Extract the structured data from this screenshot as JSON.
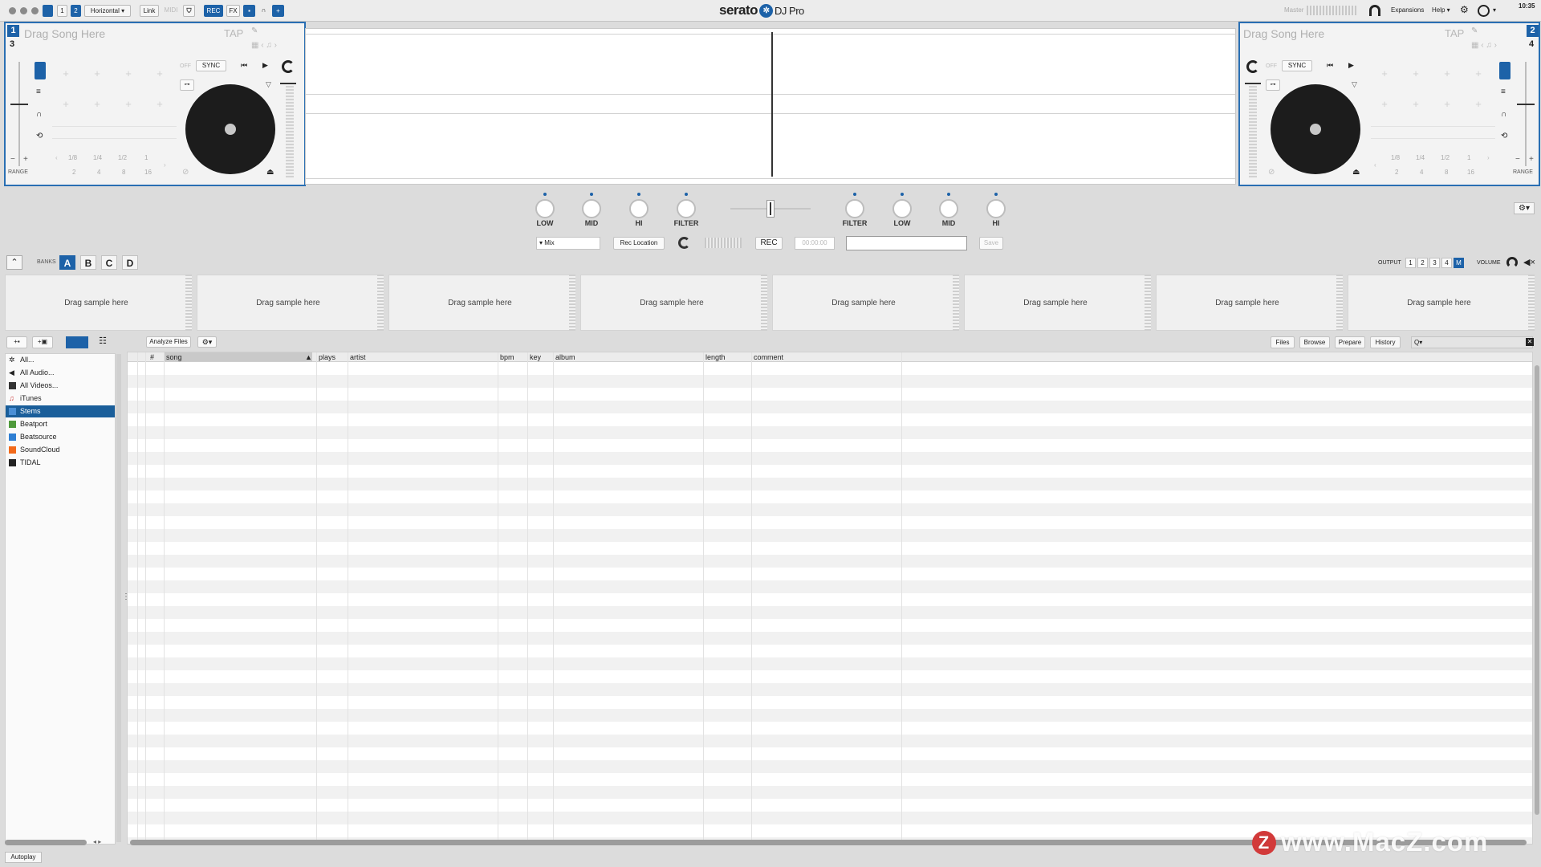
{
  "topbar": {
    "deck1": "1",
    "deck2": "2",
    "layout": "Horizontal ▾",
    "link": "Link",
    "midi": "MIDI",
    "rec": "REC",
    "fx": "FX",
    "logo_brand": "serato",
    "logo_product": "DJ Pro",
    "master": "Master",
    "expansions": "Expansions",
    "help": "Help ▾",
    "clock": "10:35"
  },
  "deck_left": {
    "number": "1",
    "sub_number": "3",
    "drag_text": "Drag Song Here",
    "tap": "TAP",
    "off": "OFF",
    "sync": "SYNC",
    "range": "RANGE",
    "minus": "−",
    "plus": "+",
    "loops_top": [
      "1/8",
      "1/4",
      "1/2",
      "1"
    ],
    "loops_bottom": [
      "2",
      "4",
      "8",
      "16"
    ]
  },
  "deck_right": {
    "number": "2",
    "sub_number": "4",
    "drag_text": "Drag Song Here",
    "tap": "TAP",
    "off": "OFF",
    "sync": "SYNC",
    "range": "RANGE",
    "minus": "−",
    "plus": "+",
    "loops_top": [
      "1/8",
      "1/4",
      "1/2",
      "1"
    ],
    "loops_bottom": [
      "2",
      "4",
      "8",
      "16"
    ]
  },
  "mixer": {
    "left_knobs": [
      "LOW",
      "MID",
      "HI",
      "FILTER"
    ],
    "right_knobs": [
      "FILTER",
      "LOW",
      "MID",
      "HI"
    ],
    "mix_source": "▾ Mix",
    "rec_location": "Rec Location",
    "rec": "REC",
    "rec_time": "00:00:00",
    "save": "Save"
  },
  "sampler": {
    "banks_label": "BANKS",
    "banks": [
      "A",
      "B",
      "C",
      "D"
    ],
    "active_bank": "A",
    "output_label": "OUTPUT",
    "outputs": [
      "1",
      "2",
      "3",
      "4",
      "M"
    ],
    "volume_label": "VOLUME",
    "slot_text": "Drag sample here"
  },
  "library": {
    "analyze": "Analyze Files",
    "tabs": [
      "Files",
      "Browse",
      "Prepare",
      "History"
    ],
    "search_placeholder": "Q▾",
    "columns": [
      "#",
      "song",
      "plays",
      "artist",
      "bpm",
      "key",
      "album",
      "length",
      "comment"
    ],
    "crates": [
      {
        "label": "All...",
        "icon": "all-icon"
      },
      {
        "label": "All Audio...",
        "icon": "speaker-icon"
      },
      {
        "label": "All Videos...",
        "icon": "film-icon"
      },
      {
        "label": "iTunes",
        "icon": "music-note-icon"
      },
      {
        "label": "Stems",
        "icon": "stems-icon"
      },
      {
        "label": "Beatport",
        "icon": "beatport-icon"
      },
      {
        "label": "Beatsource",
        "icon": "beatsource-icon"
      },
      {
        "label": "SoundCloud",
        "icon": "soundcloud-icon"
      },
      {
        "label": "TIDAL",
        "icon": "tidal-icon"
      }
    ],
    "selected_crate": "Stems",
    "autoplay": "Autoplay"
  },
  "watermark": {
    "text": "www.MacZ.com",
    "badge": "Z"
  },
  "colors": {
    "accent": "#1d62a8",
    "selected": "#1a5e9a"
  }
}
